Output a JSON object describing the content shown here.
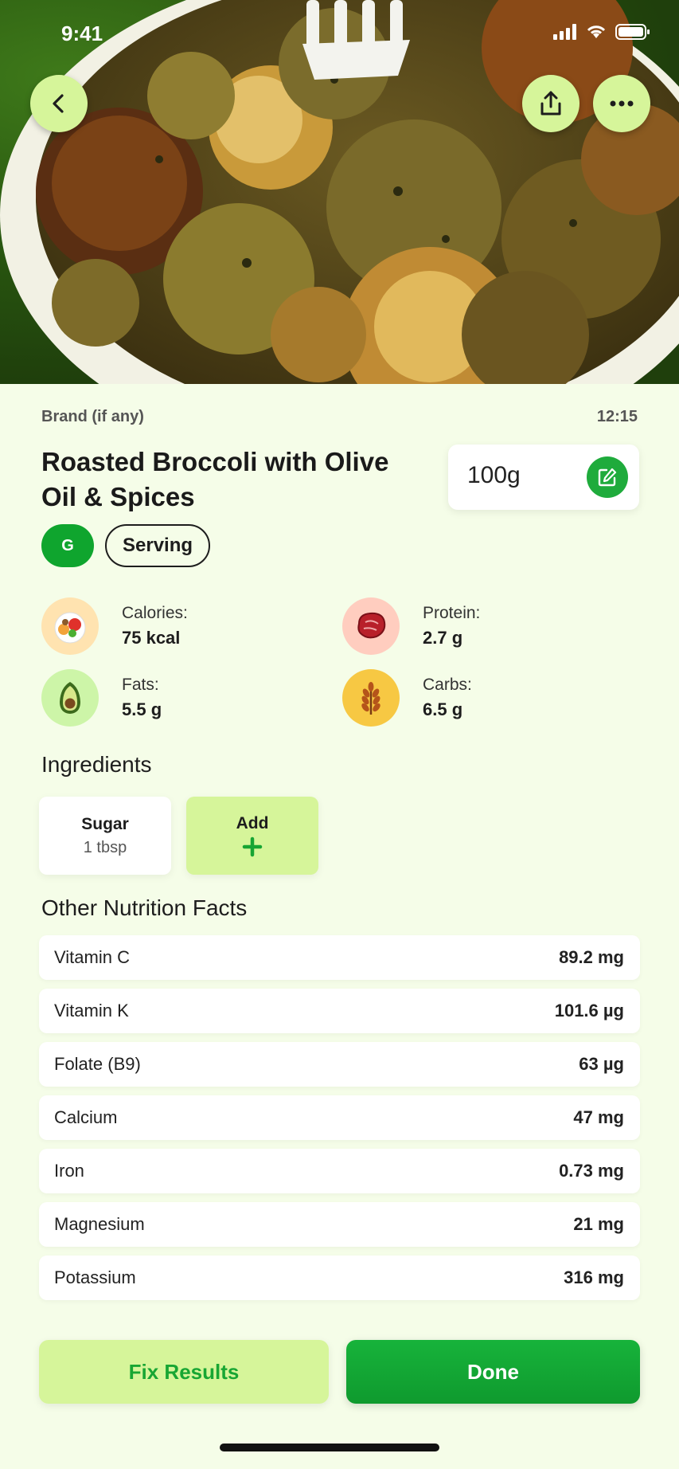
{
  "status_bar": {
    "time": "9:41"
  },
  "header": {
    "back_icon": "chevron-left-icon",
    "share_icon": "share-icon",
    "more_icon": "ellipsis-icon"
  },
  "food": {
    "brand_label": "Brand (if any)",
    "time": "12:15",
    "title": "Roasted Broccoli with Olive Oil & Spices",
    "weight": "100g",
    "edit_icon": "edit-icon",
    "units": {
      "grams": "G",
      "serving": "Serving"
    }
  },
  "macros": [
    {
      "label": "Calories:",
      "value": "75 kcal",
      "icon": "food-plate-icon"
    },
    {
      "label": "Protein:",
      "value": "2.7 g",
      "icon": "steak-icon"
    },
    {
      "label": "Fats:",
      "value": "5.5 g",
      "icon": "avocado-icon"
    },
    {
      "label": "Carbs:",
      "value": "6.5 g",
      "icon": "wheat-icon"
    }
  ],
  "ingredients": {
    "title": "Ingredients",
    "items": [
      {
        "name": "Sugar",
        "qty": "1 tbsp"
      }
    ],
    "add_label": "Add"
  },
  "nutrition": {
    "title": "Other Nutrition Facts",
    "rows": [
      {
        "name": "Vitamin C",
        "value": "89.2 mg"
      },
      {
        "name": "Vitamin K",
        "value": "101.6 µg"
      },
      {
        "name": "Folate (B9)",
        "value": "63 µg"
      },
      {
        "name": "Calcium",
        "value": "47 mg"
      },
      {
        "name": "Iron",
        "value": "0.73 mg"
      },
      {
        "name": "Magnesium",
        "value": "21 mg"
      },
      {
        "name": "Potassium",
        "value": "316 mg"
      }
    ]
  },
  "actions": {
    "fix_label": "Fix Results",
    "done_label": "Done"
  },
  "colors": {
    "accent_green": "#0fa52e",
    "light_green": "#d6f59a",
    "background": "#f5fde8"
  }
}
